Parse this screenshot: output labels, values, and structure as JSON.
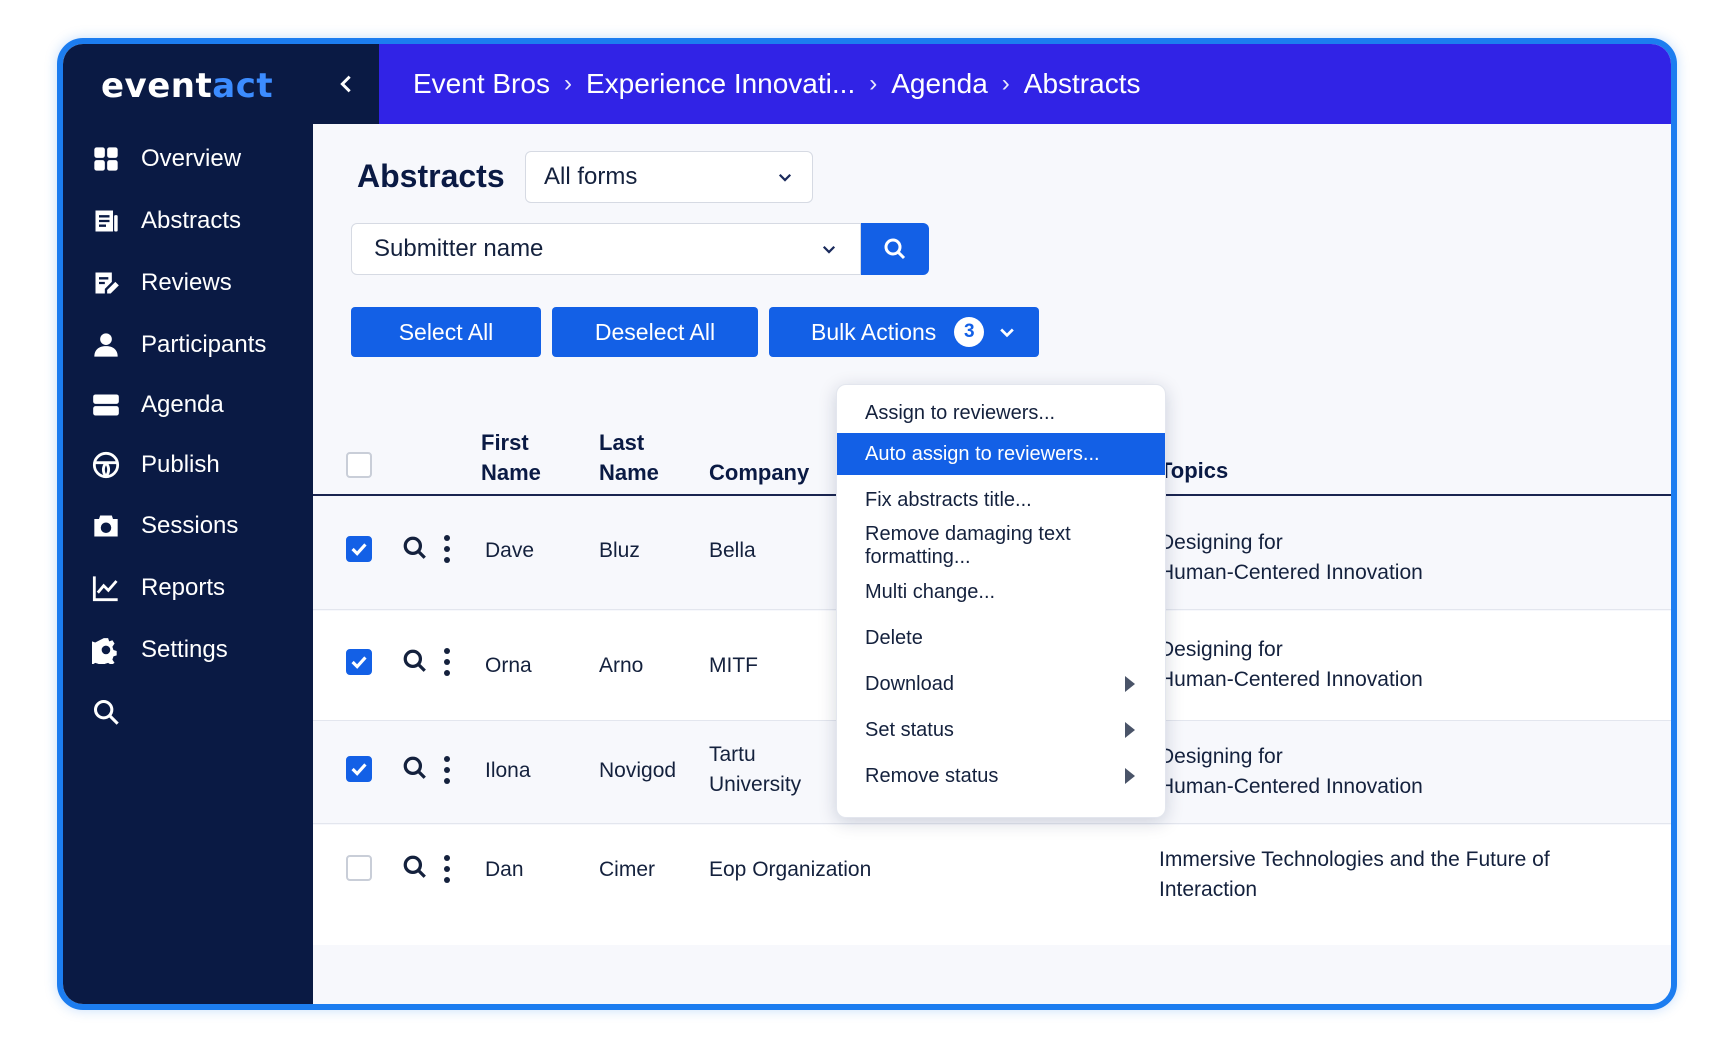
{
  "logo": {
    "part1": "event",
    "part2": "act"
  },
  "sidebar": {
    "items": [
      {
        "label": "Overview",
        "icon": "grid-icon"
      },
      {
        "label": "Abstracts",
        "icon": "document-list-icon"
      },
      {
        "label": "Reviews",
        "icon": "edit-note-icon"
      },
      {
        "label": "Participants",
        "icon": "person-icon"
      },
      {
        "label": "Agenda",
        "icon": "agenda-icon"
      },
      {
        "label": "Publish",
        "icon": "globe-icon"
      },
      {
        "label": "Sessions",
        "icon": "camera-icon"
      },
      {
        "label": "Reports",
        "icon": "line-chart-icon"
      },
      {
        "label": "Settings",
        "icon": "gear-icon"
      },
      {
        "label": "",
        "icon": "search-icon"
      }
    ]
  },
  "breadcrumb": {
    "items": [
      "Event Bros",
      "Experience Innovati...",
      "Agenda",
      "Abstracts"
    ],
    "separator": "›"
  },
  "page": {
    "title": "Abstracts"
  },
  "filters": {
    "form_select_value": "All forms",
    "search_field_value": "Submitter name"
  },
  "actions": {
    "select_all": "Select All",
    "deselect_all": "Deselect All",
    "bulk_actions": "Bulk Actions",
    "bulk_count": "3"
  },
  "bulk_menu": {
    "items": [
      {
        "label": "Assign to reviewers...",
        "active": false,
        "submenu": false
      },
      {
        "label": "Auto assign to reviewers...",
        "active": true,
        "submenu": false
      },
      {
        "label": "Fix abstracts title...",
        "active": false,
        "submenu": false
      },
      {
        "label": "Remove damaging text formatting...",
        "active": false,
        "submenu": false
      },
      {
        "label": "Multi change...",
        "active": false,
        "submenu": false
      },
      {
        "label": "Delete",
        "active": false,
        "submenu": false
      },
      {
        "label": "Download",
        "active": false,
        "submenu": true
      },
      {
        "label": "Set status",
        "active": false,
        "submenu": true
      },
      {
        "label": "Remove status",
        "active": false,
        "submenu": true
      }
    ]
  },
  "table": {
    "columns": {
      "first_name_1": "First",
      "first_name_2": "Name",
      "last_name_1": "Last",
      "last_name_2": "Name",
      "company": "Company",
      "topics": "Topics"
    },
    "rows": [
      {
        "checked": true,
        "first": "Dave",
        "last": "Bluz",
        "company_1": "Bella",
        "company_2": "",
        "topic_1": "Designing for",
        "topic_2": "Human-Centered Innovation"
      },
      {
        "checked": true,
        "first": "Orna",
        "last": "Arno",
        "company_1": "MITF",
        "company_2": "",
        "topic_1": "Designing for",
        "topic_2": "Human-Centered Innovation"
      },
      {
        "checked": true,
        "first": "Ilona",
        "last": "Novigod",
        "company_1": "Tartu",
        "company_2": "University",
        "topic_1": "Designing for",
        "topic_2": "Human-Centered Innovation"
      },
      {
        "checked": false,
        "first": "Dan",
        "last": "Cimer",
        "company_1": "Eop Organization",
        "company_2": "",
        "topic_1": "Immersive Technologies and the Future of",
        "topic_2": "Interaction"
      }
    ]
  },
  "colors": {
    "sidebar": "#0a1a44",
    "header": "#3123e6",
    "primary": "#1360e6",
    "frame": "#1c7df0"
  }
}
